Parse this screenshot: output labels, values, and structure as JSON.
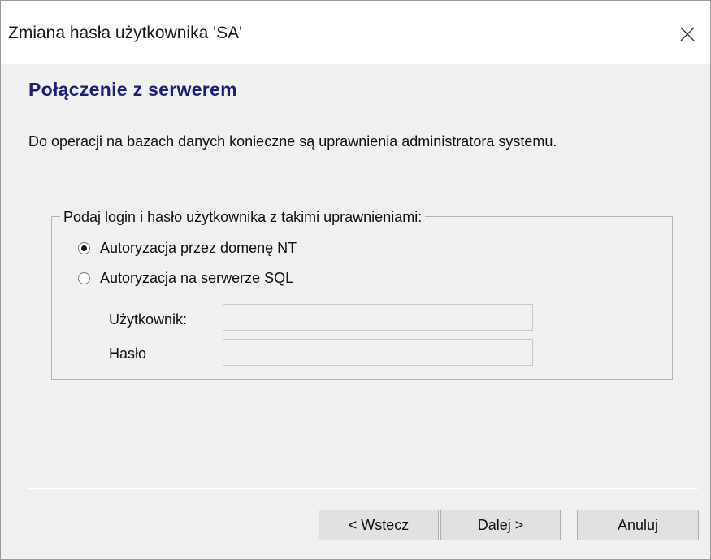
{
  "window": {
    "title": "Zmiana hasła użytkownika 'SA'",
    "close_icon": "close-icon"
  },
  "page": {
    "heading": "Połączenie z serwerem",
    "description": "Do operacji na bazach danych konieczne są uprawnienia administratora systemu."
  },
  "group": {
    "legend": "Podaj login i hasło użytkownika z takimi uprawnieniami:",
    "options": [
      {
        "label": "Autoryzacja przez domenę NT",
        "checked": true
      },
      {
        "label": "Autoryzacja na serwerze SQL",
        "checked": false
      }
    ],
    "fields": {
      "user_label": "Użytkownik:",
      "user_value": "",
      "password_label": "Hasło",
      "password_value": ""
    }
  },
  "buttons": {
    "back": "< Wstecz",
    "next": "Dalej >",
    "cancel": "Anuluj"
  },
  "colors": {
    "heading": "#1e1e78",
    "background": "#f0f0f0",
    "titlebar": "#ffffff"
  }
}
